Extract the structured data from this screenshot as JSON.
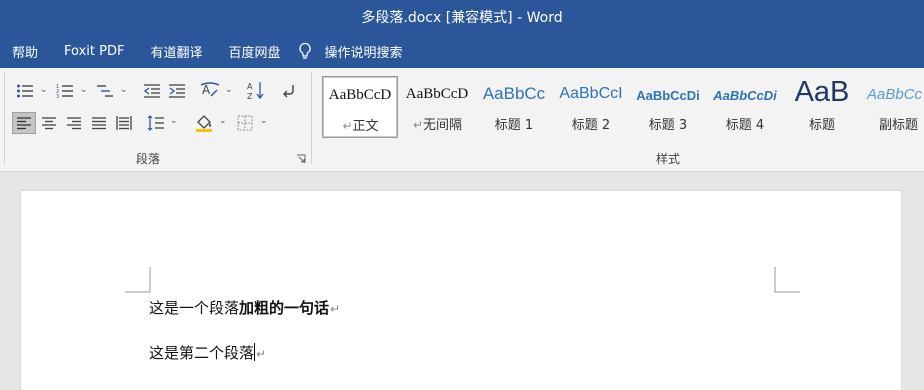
{
  "window": {
    "title": "多段落.docx [兼容模式]  -  Word"
  },
  "menu": {
    "items": [
      "帮助",
      "Foxit PDF",
      "有道翻译",
      "百度网盘"
    ],
    "tell_me": "操作说明搜索"
  },
  "ribbon": {
    "paragraph_group_label": "段落",
    "styles_group_label": "样式",
    "styles": [
      {
        "sample": "AaBbCcD",
        "name": "正文",
        "selected": true
      },
      {
        "sample": "AaBbCcD",
        "name": "无间隔",
        "selected": false
      },
      {
        "sample": "AaBbCc",
        "name": "标题 1",
        "selected": false
      },
      {
        "sample": "AaBbCcI",
        "name": "标题 2",
        "selected": false
      },
      {
        "sample": "AaBbCcDi",
        "name": "标题 3",
        "selected": false
      },
      {
        "sample": "AaBbCcDi",
        "name": "标题 4",
        "selected": false
      },
      {
        "sample": "AaB",
        "name": "标题",
        "selected": false
      },
      {
        "sample": "AaBbCc",
        "name": "副标题",
        "selected": false
      }
    ],
    "pilcrow_prefix": "↵"
  },
  "document": {
    "paragraphs": [
      {
        "normal": "这是一个段落",
        "bold": "加粗的一句话"
      },
      {
        "normal": "这是第二个段落",
        "bold": ""
      }
    ],
    "paragraph_mark": "↵"
  },
  "colors": {
    "brand": "#2b579a",
    "heading_blue": "#2e74b5",
    "title_navy": "#1f3864"
  }
}
